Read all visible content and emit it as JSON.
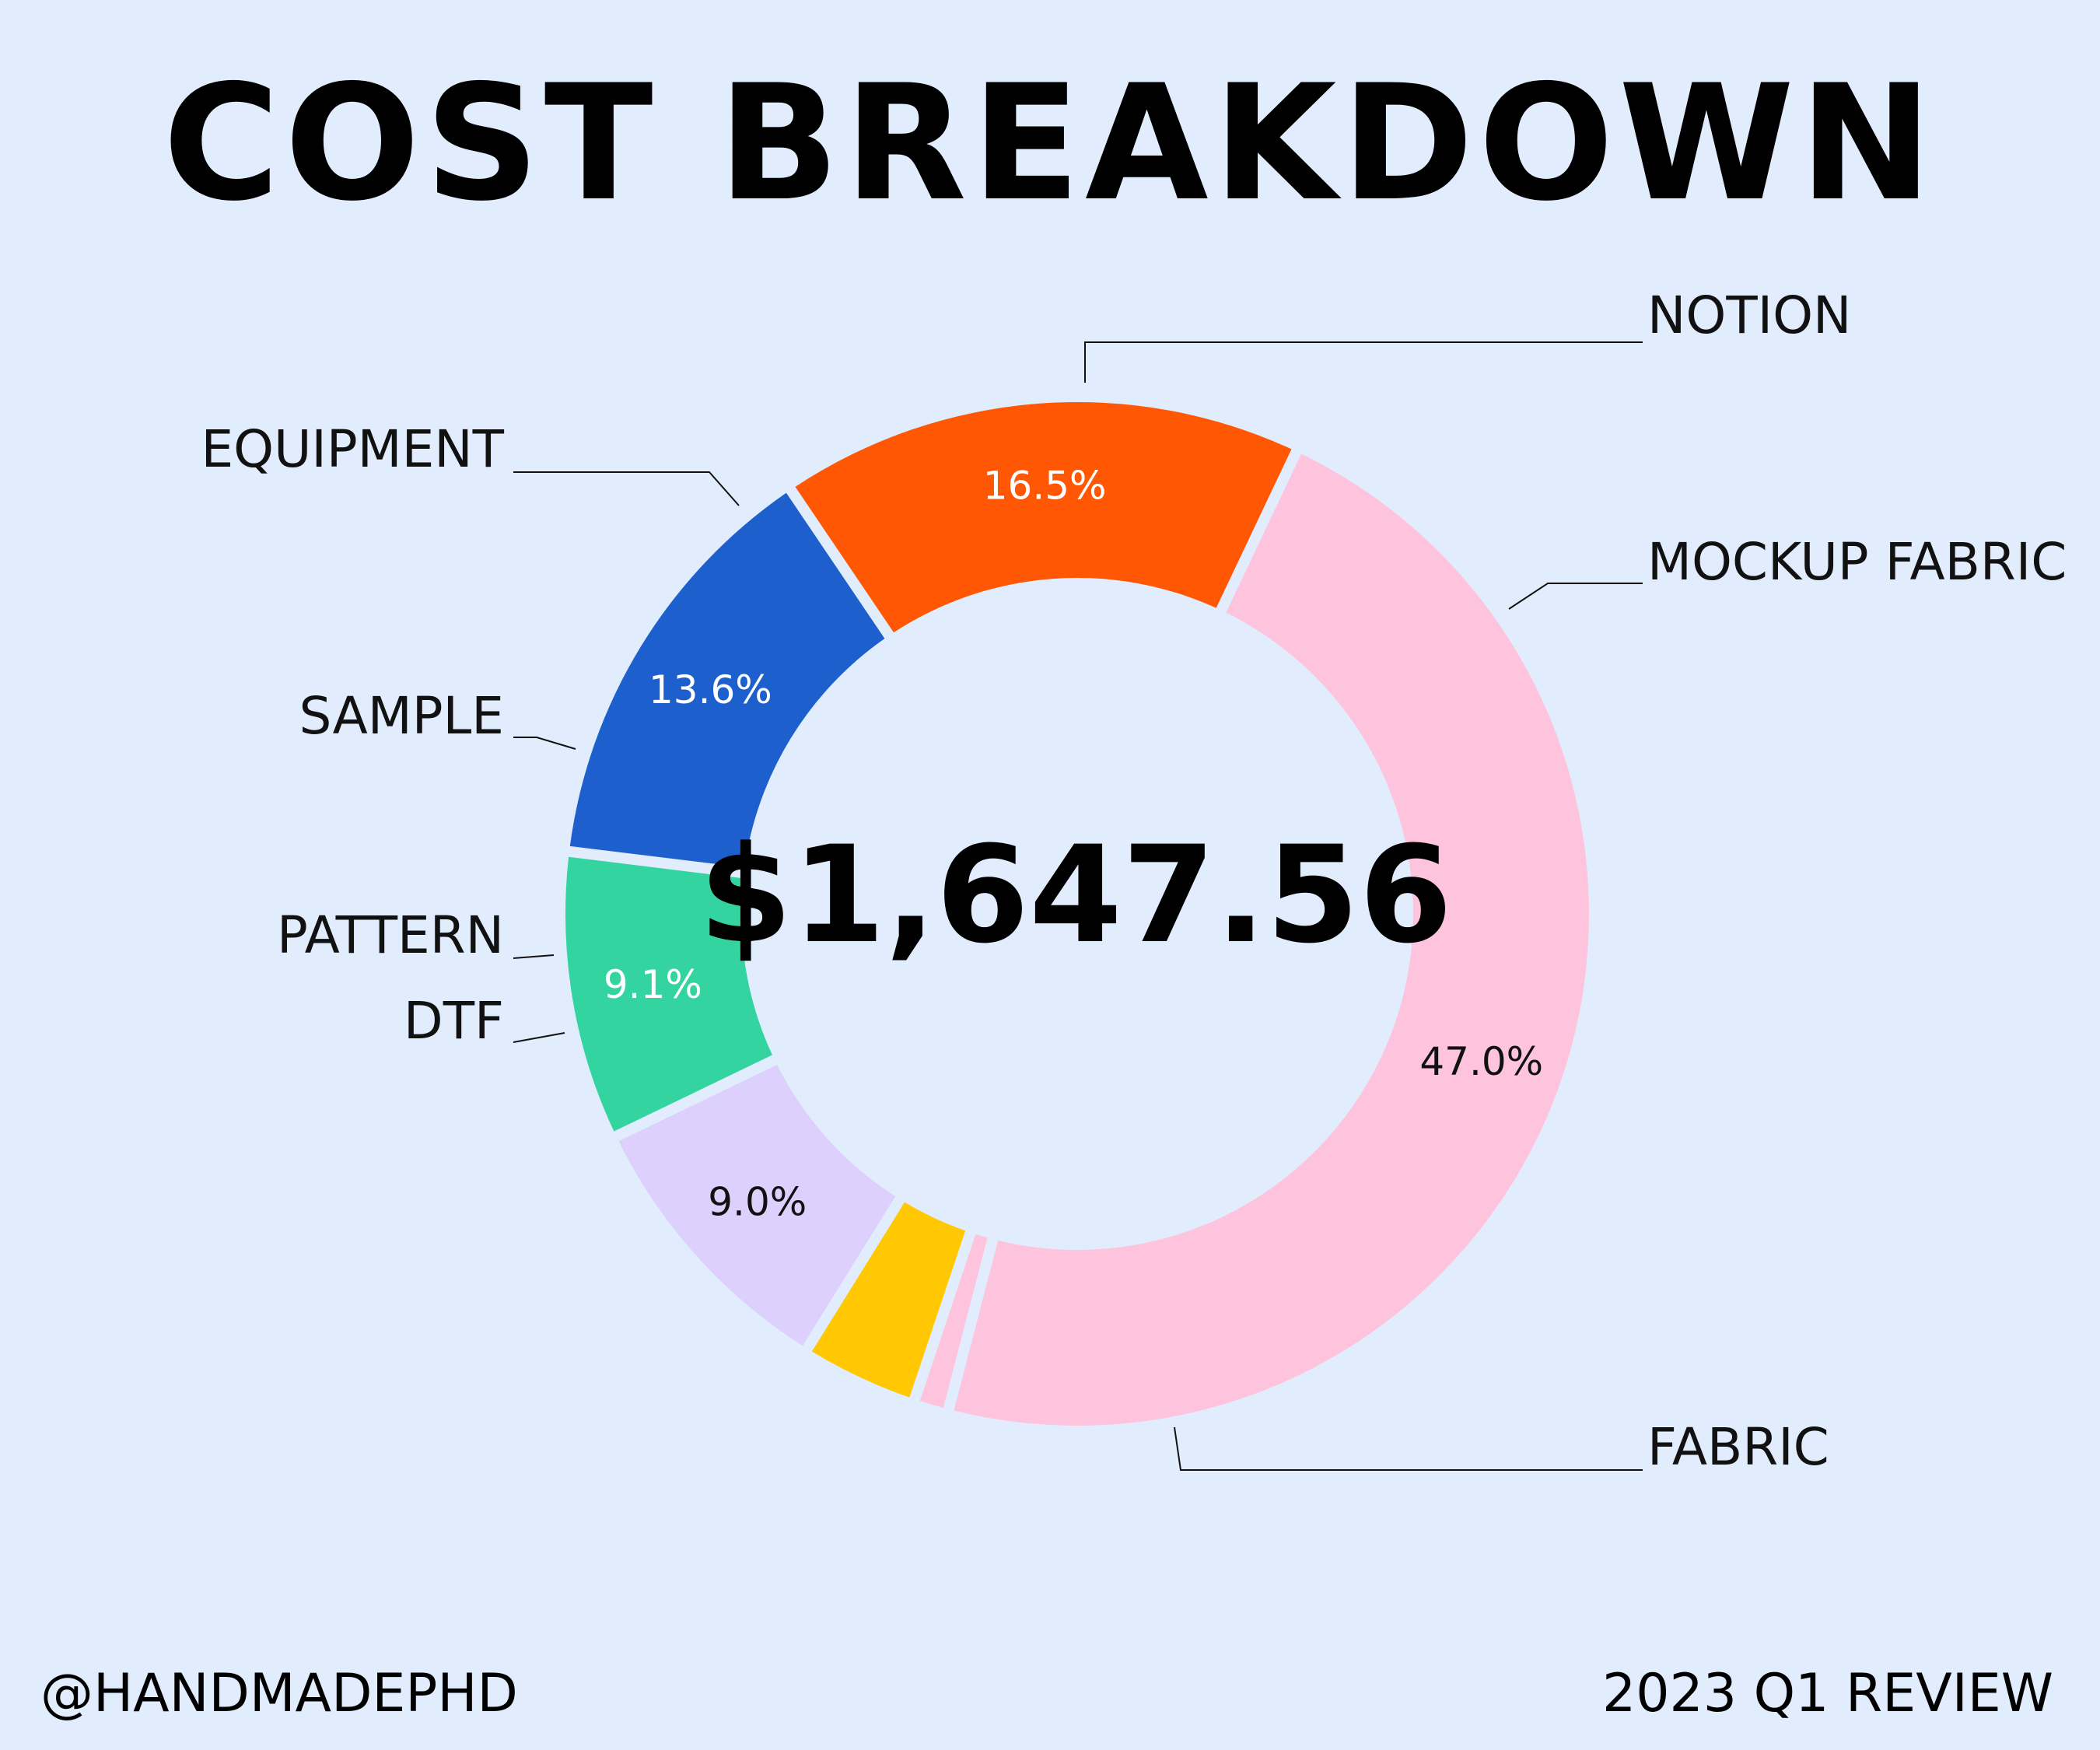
{
  "footer": {
    "handle": "@HANDMADEPHD",
    "period": "2023 Q1 REVIEW"
  },
  "chart_data": {
    "type": "pie",
    "style": "donut",
    "title": "COST BREAKDOWN",
    "center_label": "$1,647.56",
    "background_color": "#e1edfd",
    "slices": [
      {
        "name": "NOTION",
        "value": 13.6,
        "label": "13.6%",
        "color": "#1d5fcc",
        "label_color": "#ffffff"
      },
      {
        "name": "MOCKUP FABRIC",
        "value": 16.5,
        "label": "16.5%",
        "color": "#ff5703",
        "label_color": "#ffffff"
      },
      {
        "name": "FABRIC",
        "value": 47.0,
        "label": "47.0%",
        "color": "#ffc4dd",
        "label_color": "#111111"
      },
      {
        "name": "DTF",
        "value": 1.1,
        "label": "",
        "color": "#ffc4dd",
        "label_color": "#111111"
      },
      {
        "name": "PATTERN",
        "value": 3.7,
        "label": "",
        "color": "#ffc803",
        "label_color": "#111111"
      },
      {
        "name": "SAMPLE",
        "value": 9.0,
        "label": "9.0%",
        "color": "#ddd0fc",
        "label_color": "#111111"
      },
      {
        "name": "EQUIPMENT",
        "value": 9.1,
        "label": "9.1%",
        "color": "#34d4a1",
        "label_color": "#ffffff"
      }
    ]
  }
}
